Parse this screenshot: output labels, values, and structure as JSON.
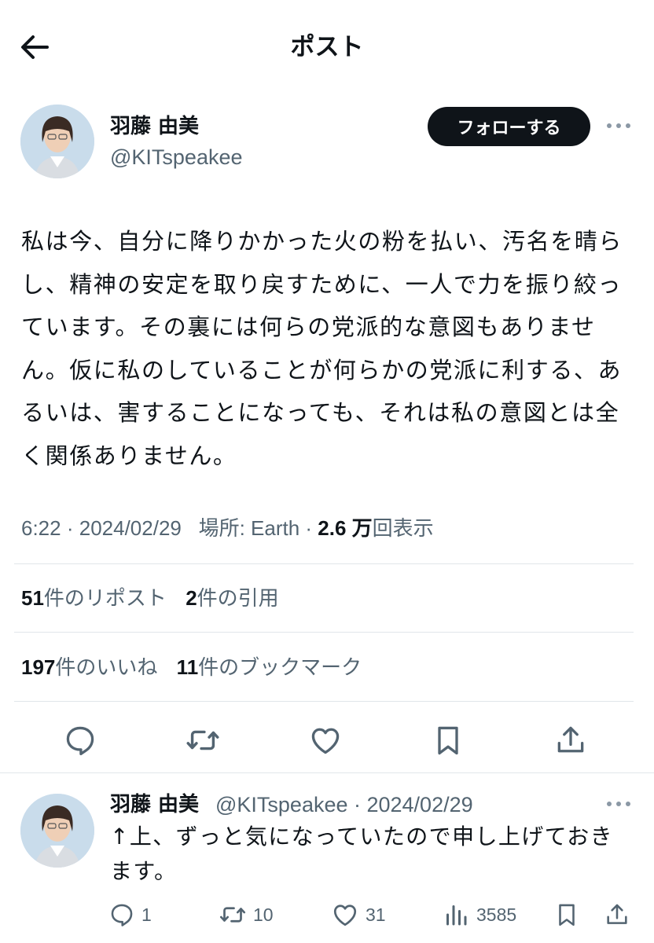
{
  "header": {
    "title": "ポスト"
  },
  "author": {
    "name": "羽藤 由美",
    "handle": "@KITspeakee"
  },
  "follow_label": "フォローする",
  "post": {
    "text": "私は今、自分に降りかかった火の粉を払い、汚名を晴らし、精神の安定を取り戻すために、一人で力を振り絞っています。その裏には何らの党派的な意図もありません。仮に私のしていることが何らかの党派に利する、あるいは、害することになっても、それは私の意図とは全く関係ありません。",
    "time": "6:22",
    "date": "2024/02/29",
    "location": "場所: Earth",
    "views_count": "2.6 万",
    "views_label": "回表示"
  },
  "stats": {
    "reposts": {
      "count": "51",
      "label": "件のリポスト"
    },
    "quotes": {
      "count": "2",
      "label": "件の引用"
    },
    "likes": {
      "count": "197",
      "label": "件のいいね"
    },
    "bookmarks": {
      "count": "11",
      "label": "件のブックマーク"
    }
  },
  "icons": [
    "back-arrow-icon",
    "more-icon",
    "reply-icon",
    "repost-icon",
    "like-icon",
    "bookmark-icon",
    "share-icon",
    "views-icon"
  ],
  "reply": {
    "name": "羽藤 由美",
    "handle_date": "@KITspeakee · 2024/02/29",
    "text": "↑上、ずっと気になっていたので申し上げておきます。",
    "replies": "1",
    "reposts": "10",
    "likes": "31",
    "views": "3585"
  },
  "colors": {
    "text": "#0f1419",
    "secondary": "#536471",
    "divider": "#e1e6ea",
    "button": "#0f1419"
  }
}
